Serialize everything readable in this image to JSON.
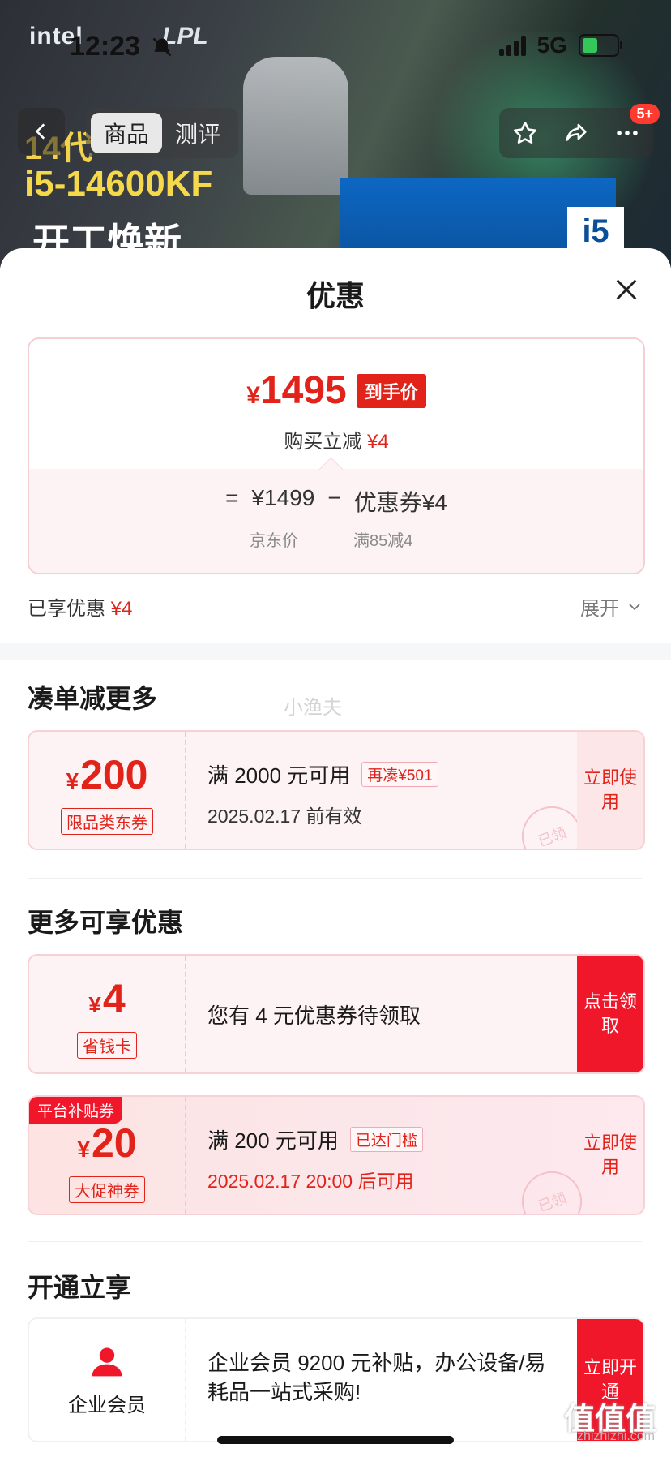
{
  "status_bar": {
    "time": "12:23",
    "network": "5G"
  },
  "banner": {
    "brand": "intel",
    "brand2": "LPL",
    "promo_line1": "14代",
    "promo_model": "i5-14600KF",
    "promo_line3": "开工焕新",
    "box_label": "i5"
  },
  "nav": {
    "tabs": [
      {
        "label": "商品",
        "active": true
      },
      {
        "label": "测评",
        "active": false
      }
    ],
    "more_badge": "5+"
  },
  "sheet": {
    "title": "优惠",
    "price": {
      "currency": "¥",
      "final_price": "1495",
      "final_tag": "到手价",
      "sub_label": "购买立减",
      "sub_amount": "¥4",
      "formula_eq": "=",
      "jd_price": "¥1499",
      "formula_minus": "−",
      "coupon_part": "优惠券¥4",
      "jd_price_label": "京东价",
      "coupon_part_label": "满85减4"
    },
    "enjoyed_label": "已享优惠",
    "enjoyed_amount": "¥4",
    "expand_label": "展开"
  },
  "watermark": "小渔夫",
  "section_more": {
    "title": "凑单减更多",
    "coupon": {
      "currency": "¥",
      "amount": "200",
      "kind": "限品类东券",
      "condition": "满 2000 元可用",
      "extra_tag": "再凑¥501",
      "validity": "2025.02.17 前有效",
      "action": "立即使用",
      "stamp": "已领"
    }
  },
  "section_extra": {
    "title": "更多可享优惠",
    "coupon_card": {
      "currency": "¥",
      "amount": "4",
      "kind": "省钱卡",
      "text": "您有 4 元优惠券待领取",
      "action": "点击领取"
    },
    "coupon_platform": {
      "platform_tag": "平台补贴券",
      "currency": "¥",
      "amount": "20",
      "kind": "大促神券",
      "condition": "满 200 元可用",
      "extra_tag": "已达门槛",
      "validity": "2025.02.17 20:00 后可用",
      "action": "立即使用",
      "stamp": "已领"
    }
  },
  "section_open": {
    "title": "开通立享",
    "member": {
      "name": "企业会员",
      "desc": "企业会员 9200 元补贴，办公设备/易耗品一站式采购!",
      "action": "立即开通"
    }
  },
  "corner": {
    "logo": "值值值",
    "url": "zhizhizhi.com"
  },
  "colors": {
    "accent": "#e2231a",
    "accent_solid": "#f0172b",
    "card_bg": "#fdf3f4"
  },
  "icons": [
    "bell-slash-icon",
    "back-icon",
    "star-icon",
    "share-icon",
    "more-icon",
    "close-icon",
    "chevron-down-icon",
    "user-icon"
  ]
}
